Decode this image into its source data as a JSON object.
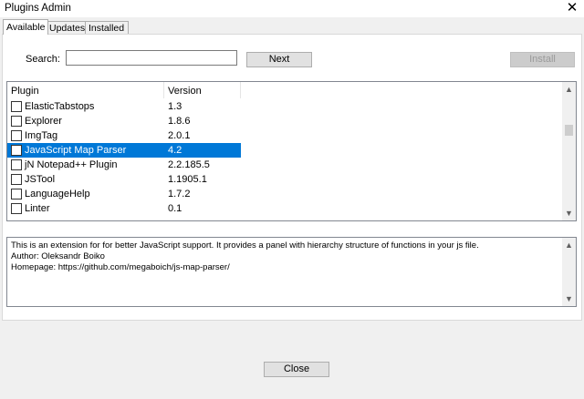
{
  "window": {
    "title": "Plugins Admin",
    "close_glyph": "✕"
  },
  "tabs": [
    {
      "label": "Available",
      "active": true
    },
    {
      "label": "Updates",
      "active": false
    },
    {
      "label": "Installed",
      "active": false
    }
  ],
  "search": {
    "label": "Search:",
    "value": "",
    "placeholder": ""
  },
  "buttons": {
    "next": "Next",
    "install": "Install",
    "close": "Close"
  },
  "list": {
    "columns": [
      "Plugin",
      "Version"
    ],
    "rows": [
      {
        "name": "ElasticTabstops",
        "version": "1.3",
        "checked": false,
        "selected": false
      },
      {
        "name": "Explorer",
        "version": "1.8.6",
        "checked": false,
        "selected": false
      },
      {
        "name": "ImgTag",
        "version": "2.0.1",
        "checked": false,
        "selected": false
      },
      {
        "name": "JavaScript Map Parser",
        "version": "4.2",
        "checked": false,
        "selected": true
      },
      {
        "name": "jN Notepad++ Plugin",
        "version": "2.2.185.5",
        "checked": false,
        "selected": false
      },
      {
        "name": "JSTool",
        "version": "1.1905.1",
        "checked": false,
        "selected": false
      },
      {
        "name": "LanguageHelp",
        "version": "1.7.2",
        "checked": false,
        "selected": false
      },
      {
        "name": "Linter",
        "version": "0.1",
        "checked": false,
        "selected": false
      }
    ]
  },
  "description": {
    "lines": [
      "This is an extension for for better JavaScript support. It provides a panel with hierarchy structure of functions in your js file.",
      "Author: Oleksandr Boiko",
      "Homepage: https://github.com/megaboich/js-map-parser/"
    ]
  },
  "icons": {
    "scroll_up": "chevron-up-icon",
    "scroll_down": "chevron-down-icon",
    "close": "close-icon"
  },
  "colors": {
    "selection": "#0078d7"
  }
}
